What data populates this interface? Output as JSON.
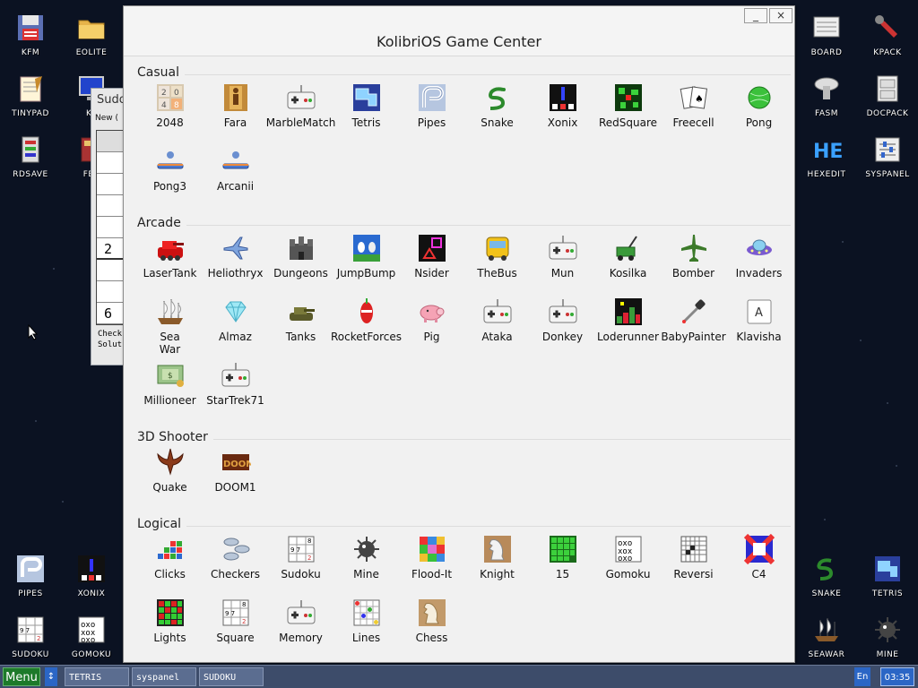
{
  "desktop_icons": [
    {
      "id": "kfm",
      "label": "KFM"
    },
    {
      "id": "eolite",
      "label": "EOLITE"
    },
    {
      "id": "tinypad",
      "label": "TINYPAD"
    },
    {
      "id": "kf",
      "label": "KF"
    },
    {
      "id": "rdsave",
      "label": "RDSAVE"
    },
    {
      "id": "fb2",
      "label": "FB2"
    },
    {
      "id": "board",
      "label": "BOARD"
    },
    {
      "id": "kpack",
      "label": "KPACK"
    },
    {
      "id": "fasm",
      "label": "FASM"
    },
    {
      "id": "docpack",
      "label": "DOCPACK"
    },
    {
      "id": "hexedit",
      "label": "HEXEDIT"
    },
    {
      "id": "syspanel",
      "label": "SYSPANEL"
    },
    {
      "id": "pipes",
      "label": "PIPES"
    },
    {
      "id": "xonix",
      "label": "XONIX"
    },
    {
      "id": "sudoku",
      "label": "SUDOKU"
    },
    {
      "id": "gomoku",
      "label": "GOMOKU"
    },
    {
      "id": "snake",
      "label": "SNAKE"
    },
    {
      "id": "tetris",
      "label": "TETRIS"
    },
    {
      "id": "seawar",
      "label": "SEAWAR"
    },
    {
      "id": "mine",
      "label": "MINE"
    }
  ],
  "sudoku_window": {
    "title": "Sudo",
    "menu": "New (",
    "cells": [
      "",
      "",
      "",
      "",
      "",
      "2",
      "",
      "",
      "6"
    ],
    "footer": [
      "Check",
      "Solut"
    ]
  },
  "window": {
    "title": "KolibriOS Game Center",
    "minimize": "_",
    "close": "×"
  },
  "sections": [
    {
      "title": "Casual",
      "apps": [
        {
          "name": "2048",
          "icon": "2048"
        },
        {
          "name": "Fara",
          "icon": "fara"
        },
        {
          "name": "MarbleMatch",
          "icon": "gamepad"
        },
        {
          "name": "Tetris",
          "icon": "tetris"
        },
        {
          "name": "Pipes",
          "icon": "pipes"
        },
        {
          "name": "Snake",
          "icon": "snake"
        },
        {
          "name": "Xonix",
          "icon": "xonix"
        },
        {
          "name": "RedSquare",
          "icon": "redsquare"
        },
        {
          "name": "Freecell",
          "icon": "cards"
        },
        {
          "name": "Pong",
          "icon": "pong"
        },
        {
          "name": "Pong3",
          "icon": "paddle"
        },
        {
          "name": "Arcanii",
          "icon": "paddle"
        }
      ]
    },
    {
      "title": "Arcade",
      "apps": [
        {
          "name": "LaserTank",
          "icon": "tank-red"
        },
        {
          "name": "Heliothryx",
          "icon": "plane-blue"
        },
        {
          "name": "Dungeons",
          "icon": "castle"
        },
        {
          "name": "JumpBump",
          "icon": "jumpbump"
        },
        {
          "name": "Nsider",
          "icon": "nsider"
        },
        {
          "name": "TheBus",
          "icon": "bus"
        },
        {
          "name": "Mun",
          "icon": "gamepad"
        },
        {
          "name": "Kosilka",
          "icon": "mower"
        },
        {
          "name": "Bomber",
          "icon": "plane-green"
        },
        {
          "name": "Invaders",
          "icon": "ufo"
        },
        {
          "name": "Sea War",
          "icon": "ship"
        },
        {
          "name": "Almaz",
          "icon": "diamond"
        },
        {
          "name": "Tanks",
          "icon": "tank"
        },
        {
          "name": "RocketForces",
          "icon": "rocket"
        },
        {
          "name": "Pig",
          "icon": "pig"
        },
        {
          "name": "Ataka",
          "icon": "gamepad"
        },
        {
          "name": "Donkey",
          "icon": "gamepad"
        },
        {
          "name": "Loderunner",
          "icon": "loderunner"
        },
        {
          "name": "BabyPainter",
          "icon": "pipette"
        },
        {
          "name": "Klavisha",
          "icon": "key-a"
        },
        {
          "name": "Millioneer",
          "icon": "money"
        },
        {
          "name": "StarTrek71",
          "icon": "gamepad"
        }
      ]
    },
    {
      "title": "3D Shooter",
      "apps": [
        {
          "name": "Quake",
          "icon": "quake"
        },
        {
          "name": "DOOM1",
          "icon": "doom"
        }
      ]
    },
    {
      "title": "Logical",
      "apps": [
        {
          "name": "Clicks",
          "icon": "clicks"
        },
        {
          "name": "Checkers",
          "icon": "checkers"
        },
        {
          "name": "Sudoku",
          "icon": "sudoku"
        },
        {
          "name": "Mine",
          "icon": "mine"
        },
        {
          "name": "Flood-It",
          "icon": "floodit"
        },
        {
          "name": "Knight",
          "icon": "knight"
        },
        {
          "name": "15",
          "icon": "fifteen"
        },
        {
          "name": "Gomoku",
          "icon": "gomoku"
        },
        {
          "name": "Reversi",
          "icon": "reversi"
        },
        {
          "name": "C4",
          "icon": "c4"
        },
        {
          "name": "Lights",
          "icon": "lights"
        },
        {
          "name": "Square",
          "icon": "square"
        },
        {
          "name": "Memory",
          "icon": "gamepad"
        },
        {
          "name": "Lines",
          "icon": "lines"
        },
        {
          "name": "Chess",
          "icon": "chess"
        }
      ]
    }
  ],
  "taskbar": {
    "menu_label": "Menu",
    "arrow_label": "↕",
    "tasks": [
      "TETRIS",
      "syspanel",
      "SUDOKU"
    ],
    "language": "En",
    "clock": "03:35"
  },
  "colors": {
    "desktop": "#0b1222",
    "taskbar": "#3d4c6a",
    "menu_button": "#1d7a2a",
    "accent_blue": "#2b66c5"
  }
}
